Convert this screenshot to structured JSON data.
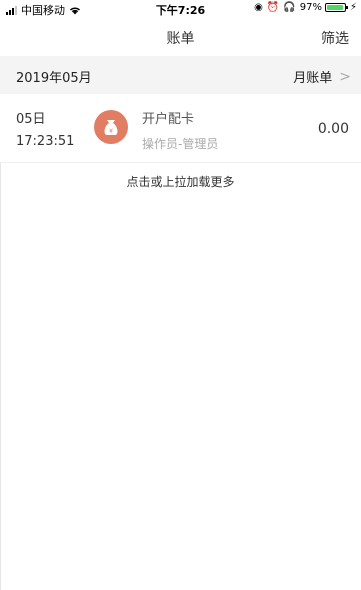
{
  "status_bar": {
    "carrier": "中国移动",
    "time": "下午7:26",
    "battery_percent_text": "97%",
    "battery_level": 0.97,
    "battery_color": "#4cd964"
  },
  "nav": {
    "title": "账单",
    "filter_label": "筛选"
  },
  "month_section": {
    "month": "2019年05月",
    "monthly_bill_label": "月账单"
  },
  "records": [
    {
      "date": "05日",
      "time": "17:23:51",
      "icon": "money-bag-icon",
      "icon_color": "#e07d63",
      "title": "开户配卡",
      "operator": "操作员-管理员",
      "amount": "0.00"
    }
  ],
  "load_more_label": "点击或上拉加载更多"
}
